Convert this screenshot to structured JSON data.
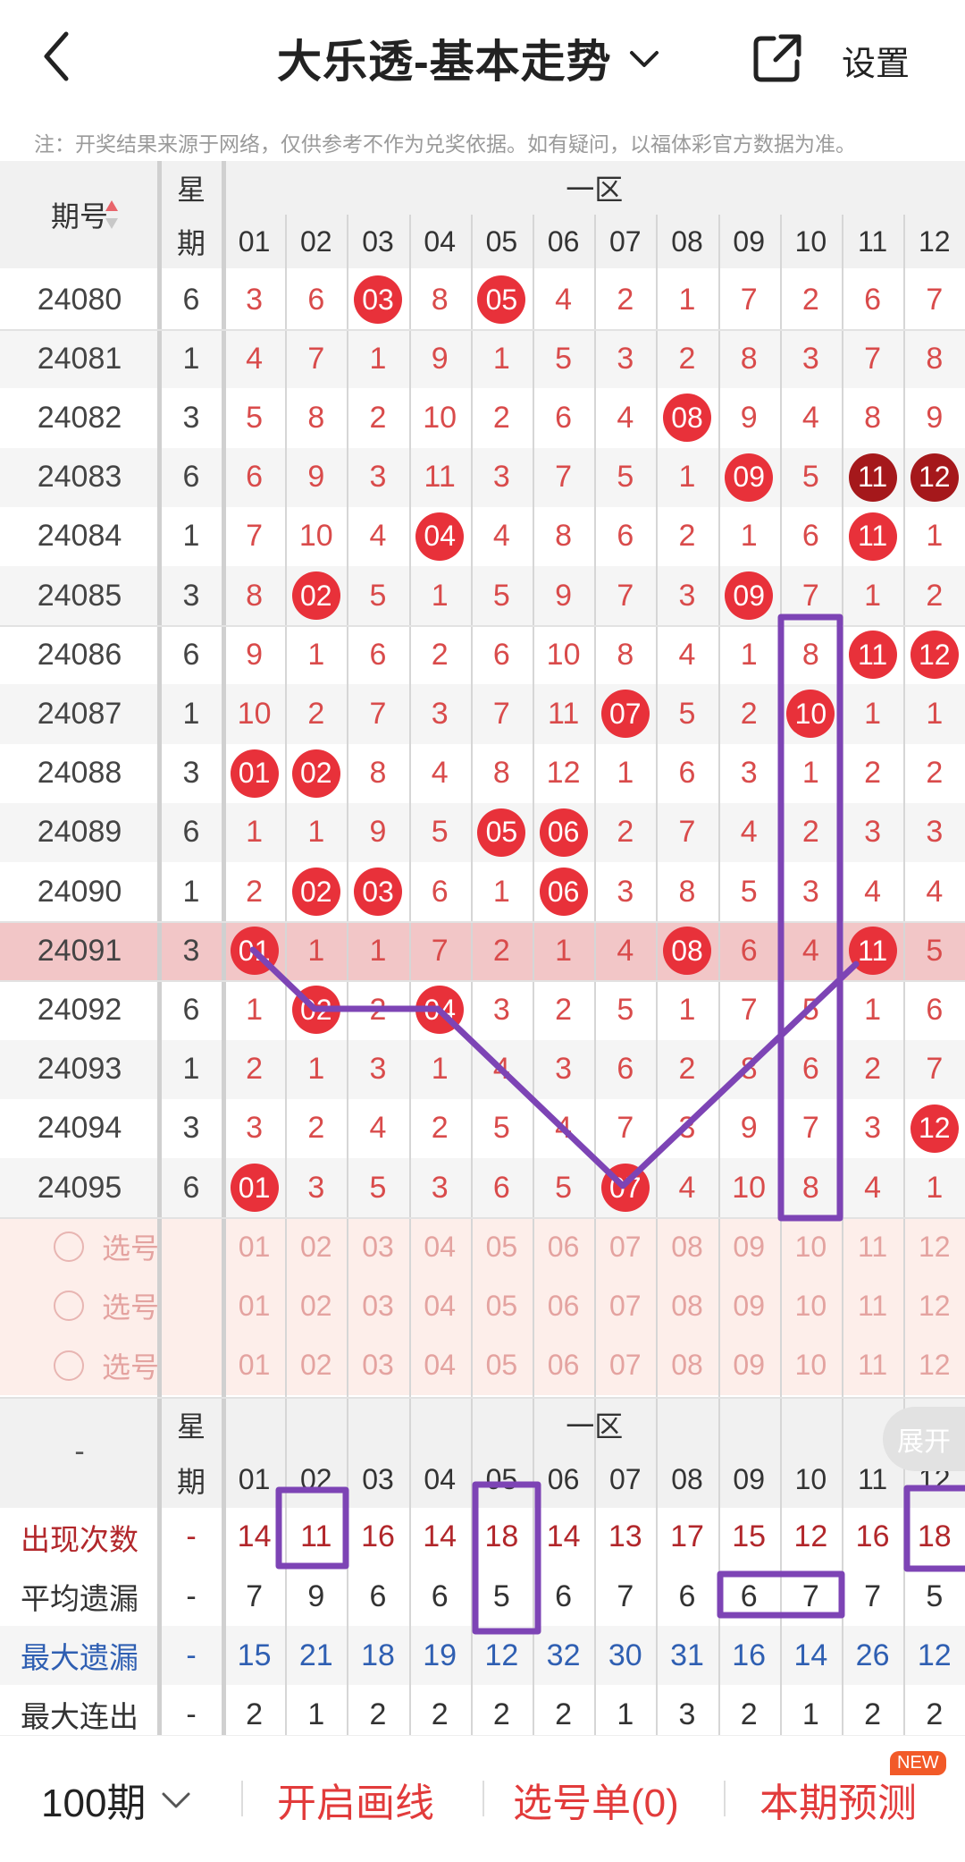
{
  "header": {
    "title": "大乐透-基本走势",
    "settings_label": "设置",
    "notice": "注：开奖结果来源于网络，仅供参考不作为兑奖依据。如有疑问，以福体彩官方数据为准。"
  },
  "table_header": {
    "period_label": "期号",
    "week_label_1": "星",
    "week_label_2": "期",
    "zone_label": "一区",
    "columns": [
      "01",
      "02",
      "03",
      "04",
      "05",
      "06",
      "07",
      "08",
      "09",
      "10",
      "11",
      "12"
    ]
  },
  "rows": [
    {
      "period": "24080",
      "week": "6",
      "cells": [
        "3",
        "6",
        "03",
        "8",
        "05",
        "4",
        "2",
        "1",
        "7",
        "2",
        "6",
        "7"
      ]
    },
    {
      "period": "24081",
      "week": "1",
      "cells": [
        "4",
        "7",
        "1",
        "9",
        "1",
        "5",
        "3",
        "2",
        "8",
        "3",
        "7",
        "8"
      ]
    },
    {
      "period": "24082",
      "week": "3",
      "cells": [
        "5",
        "8",
        "2",
        "10",
        "2",
        "6",
        "4",
        "08",
        "9",
        "4",
        "8",
        "9"
      ]
    },
    {
      "period": "24083",
      "week": "6",
      "cells": [
        "6",
        "9",
        "3",
        "11",
        "3",
        "7",
        "5",
        "1",
        "09",
        "5",
        "11",
        "12"
      ]
    },
    {
      "period": "24084",
      "week": "1",
      "cells": [
        "7",
        "10",
        "4",
        "04",
        "4",
        "8",
        "6",
        "2",
        "1",
        "6",
        "11",
        "1"
      ]
    },
    {
      "period": "24085",
      "week": "3",
      "cells": [
        "8",
        "02",
        "5",
        "1",
        "5",
        "9",
        "7",
        "3",
        "09",
        "7",
        "1",
        "2"
      ]
    },
    {
      "period": "24086",
      "week": "6",
      "cells": [
        "9",
        "1",
        "6",
        "2",
        "6",
        "10",
        "8",
        "4",
        "1",
        "8",
        "11",
        "12"
      ]
    },
    {
      "period": "24087",
      "week": "1",
      "cells": [
        "10",
        "2",
        "7",
        "3",
        "7",
        "11",
        "07",
        "5",
        "2",
        "10",
        "1",
        "1"
      ]
    },
    {
      "period": "24088",
      "week": "3",
      "cells": [
        "01",
        "02",
        "8",
        "4",
        "8",
        "12",
        "1",
        "6",
        "3",
        "1",
        "2",
        "2"
      ]
    },
    {
      "period": "24089",
      "week": "6",
      "cells": [
        "1",
        "1",
        "9",
        "5",
        "05",
        "06",
        "2",
        "7",
        "4",
        "2",
        "3",
        "3"
      ]
    },
    {
      "period": "24090",
      "week": "1",
      "cells": [
        "2",
        "02",
        "03",
        "6",
        "1",
        "06",
        "3",
        "8",
        "5",
        "3",
        "4",
        "4"
      ]
    },
    {
      "period": "24091",
      "week": "3",
      "cells": [
        "01",
        "1",
        "1",
        "7",
        "2",
        "1",
        "4",
        "08",
        "6",
        "4",
        "11",
        "5"
      ]
    },
    {
      "period": "24092",
      "week": "6",
      "cells": [
        "1",
        "02",
        "2",
        "04",
        "3",
        "2",
        "5",
        "1",
        "7",
        "5",
        "1",
        "6"
      ]
    },
    {
      "period": "24093",
      "week": "1",
      "cells": [
        "2",
        "1",
        "3",
        "1",
        "4",
        "3",
        "6",
        "2",
        "8",
        "6",
        "2",
        "7"
      ]
    },
    {
      "period": "24094",
      "week": "3",
      "cells": [
        "3",
        "2",
        "4",
        "2",
        "5",
        "4",
        "7",
        "3",
        "9",
        "7",
        "3",
        "12"
      ]
    },
    {
      "period": "24095",
      "week": "6",
      "cells": [
        "01",
        "3",
        "5",
        "3",
        "6",
        "5",
        "07",
        "4",
        "10",
        "8",
        "4",
        "1"
      ]
    }
  ],
  "pick_rows": [
    {
      "label": "选号"
    },
    {
      "label": "选号"
    },
    {
      "label": "选号"
    }
  ],
  "stats_header": {
    "dash": "-",
    "week_label_1": "星",
    "week_label_2": "期",
    "zone_label": "一区",
    "expand_label": "展开"
  },
  "stats": [
    {
      "label": "出现次数",
      "week": "-",
      "values": [
        "14",
        "11",
        "16",
        "14",
        "18",
        "14",
        "13",
        "17",
        "15",
        "12",
        "16",
        "18"
      ]
    },
    {
      "label": "平均遗漏",
      "week": "-",
      "values": [
        "7",
        "9",
        "6",
        "6",
        "5",
        "6",
        "7",
        "6",
        "6",
        "7",
        "7",
        "5"
      ]
    },
    {
      "label": "最大遗漏",
      "week": "-",
      "values": [
        "15",
        "21",
        "18",
        "19",
        "12",
        "32",
        "30",
        "31",
        "16",
        "14",
        "26",
        "12"
      ]
    },
    {
      "label": "最大连出",
      "week": "-",
      "values": [
        "2",
        "1",
        "2",
        "2",
        "2",
        "2",
        "1",
        "3",
        "2",
        "1",
        "2",
        "2"
      ]
    }
  ],
  "bottom_bar": {
    "periods": "100期",
    "draw_lines": "开启画线",
    "pick_list": "选号单(0)",
    "forecast": "本期预测",
    "new_badge": "NEW"
  },
  "colors": {
    "ball": "#e8313a",
    "ball_dark": "#a5181b",
    "miss_text": "#d94b4b",
    "highlight_row": "#f2c6c7",
    "annotation": "#7d44b5"
  }
}
